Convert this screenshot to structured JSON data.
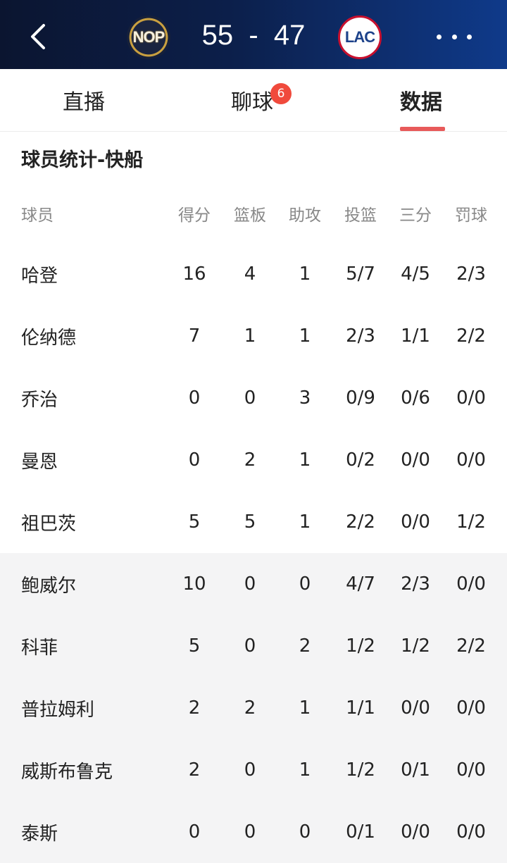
{
  "header": {
    "home_team": "NOP",
    "away_team": "LAC",
    "score": "55  -  47"
  },
  "tabs": [
    {
      "label": "直播",
      "active": false
    },
    {
      "label": "聊球",
      "active": false,
      "badge": "6"
    },
    {
      "label": "数据",
      "active": true
    }
  ],
  "section_title": "球员统计-快船",
  "table": {
    "columns": [
      "球员",
      "得分",
      "篮板",
      "助攻",
      "投篮",
      "三分",
      "罚球"
    ],
    "rows": [
      [
        "哈登",
        "16",
        "4",
        "1",
        "5/7",
        "4/5",
        "2/3"
      ],
      [
        "伦纳德",
        "7",
        "1",
        "1",
        "2/3",
        "1/1",
        "2/2"
      ],
      [
        "乔治",
        "0",
        "0",
        "3",
        "0/9",
        "0/6",
        "0/0"
      ],
      [
        "曼恩",
        "0",
        "2",
        "1",
        "0/2",
        "0/0",
        "0/0"
      ],
      [
        "祖巴茨",
        "5",
        "5",
        "1",
        "2/2",
        "0/0",
        "1/2"
      ],
      [
        "鲍威尔",
        "10",
        "0",
        "0",
        "4/7",
        "2/3",
        "0/0"
      ],
      [
        "科菲",
        "5",
        "0",
        "2",
        "1/2",
        "1/2",
        "2/2"
      ],
      [
        "普拉姆利",
        "2",
        "2",
        "1",
        "1/1",
        "0/0",
        "0/0"
      ],
      [
        "威斯布鲁克",
        "2",
        "0",
        "1",
        "1/2",
        "0/1",
        "0/0"
      ],
      [
        "泰斯",
        "0",
        "0",
        "0",
        "0/1",
        "0/0",
        "0/0"
      ]
    ]
  }
}
